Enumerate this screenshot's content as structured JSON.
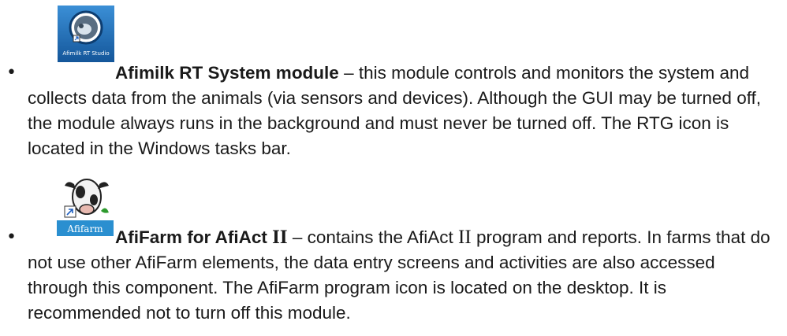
{
  "items": [
    {
      "icon": {
        "name": "afimilk-rt-studio-icon",
        "label": "Afimilk RT Studio",
        "color": "#1f6fb8"
      },
      "title": "Afimilk RT System module",
      "text": " – this module controls and monitors the system and collects data from the animals (via sensors and devices). Although the GUI may be turned off, the module always runs in the background and must never be turned off. The RTG icon is located in the Windows tasks bar."
    },
    {
      "icon": {
        "name": "afifarm-icon",
        "label": "Afifarm",
        "color": "#2a8fd0"
      },
      "title_a": "AfiFarm for AfiAct ",
      "title_roman": "II",
      "text_a": " – contains the AfiAct ",
      "text_roman": "II",
      "text_b": " program and reports. In farms that do not use other AfiFarm elements, the data entry screens and activities are also accessed through this component. The AfiFarm program icon is located on the desktop. It is recommended not to turn off this module."
    }
  ],
  "bullet": "•"
}
